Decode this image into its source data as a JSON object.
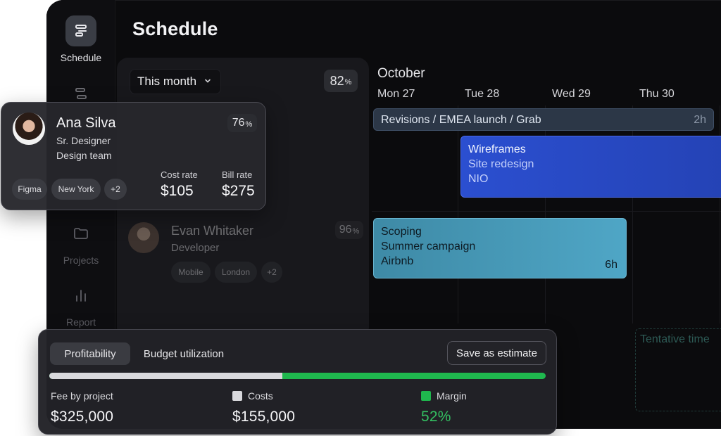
{
  "sidebar": {
    "items": [
      {
        "label": "Schedule",
        "icon": "schedule-icon"
      },
      {
        "label": "",
        "icon": "list-icon"
      },
      {
        "label": "Projects",
        "icon": "folder-icon"
      },
      {
        "label": "Report",
        "icon": "bar-chart-icon"
      }
    ]
  },
  "page": {
    "title": "Schedule"
  },
  "resources": {
    "month_filter": "This month",
    "overall_utilization": "82",
    "percent_symbol": "%",
    "people": [
      {
        "name": "Ana Silva",
        "role": "Sr. Designer",
        "team": "Design team",
        "utilization": "76",
        "tags": [
          "Figma",
          "New York",
          "+2"
        ],
        "cost_rate_label": "Cost rate",
        "cost_rate": "$105",
        "bill_rate_label": "Bill rate",
        "bill_rate": "$275"
      },
      {
        "name": "Evan Whitaker",
        "role": "Developer",
        "utilization": "96",
        "tags": [
          "Mobile",
          "London",
          "+2"
        ]
      }
    ]
  },
  "calendar": {
    "month": "October",
    "days": [
      "Mon 27",
      "Tue 28",
      "Wed 29",
      "Thu 30"
    ],
    "events": {
      "revisions": {
        "title": "Revisions / EMEA launch / Grab",
        "duration": "2h"
      },
      "wireframes": {
        "line1": "Wireframes",
        "line2": "Site redesign",
        "line3": "NIO"
      },
      "scoping": {
        "line1": "Scoping",
        "line2": "Summer campaign",
        "line3": "Airbnb",
        "duration": "6h"
      },
      "tentative": {
        "label": "Tentative time"
      }
    }
  },
  "profitability": {
    "tabs": [
      "Profitability",
      "Budget utilization"
    ],
    "active_tab": "Profitability",
    "save_button": "Save as estimate",
    "costs_share": 0.47,
    "stats": {
      "fee_label": "Fee by project",
      "fee_value": "$325,000",
      "costs_label": "Costs",
      "costs_value": "$155,000",
      "margin_label": "Margin",
      "margin_value": "52%"
    }
  },
  "colors": {
    "accent_blue": "#2b4fd0",
    "accent_teal": "#4fa6c6",
    "margin_green": "#1fb84e",
    "costs_gray": "#d9d9dd"
  }
}
